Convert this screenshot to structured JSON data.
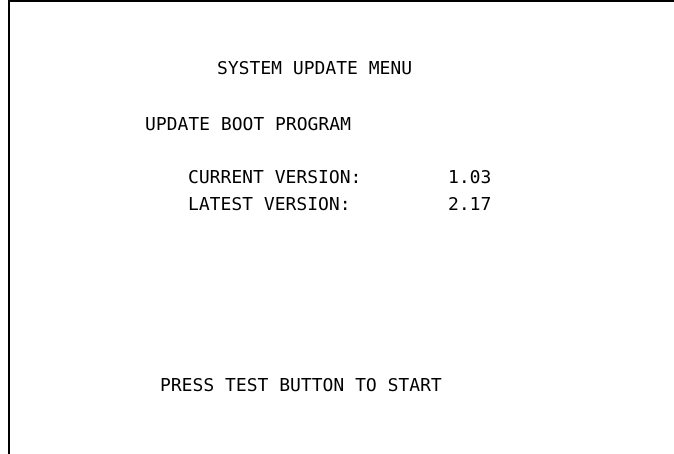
{
  "menu": {
    "title": "SYSTEM UPDATE MENU",
    "section": "UPDATE BOOT PROGRAM",
    "current_version_label": "CURRENT VERSION:",
    "current_version_value": "1.03",
    "latest_version_label": "LATEST VERSION:",
    "latest_version_value": "2.17",
    "prompt": "PRESS TEST BUTTON TO START"
  },
  "colors": {
    "background": "#ffffff",
    "text": "#000000",
    "frame": "#000000"
  }
}
